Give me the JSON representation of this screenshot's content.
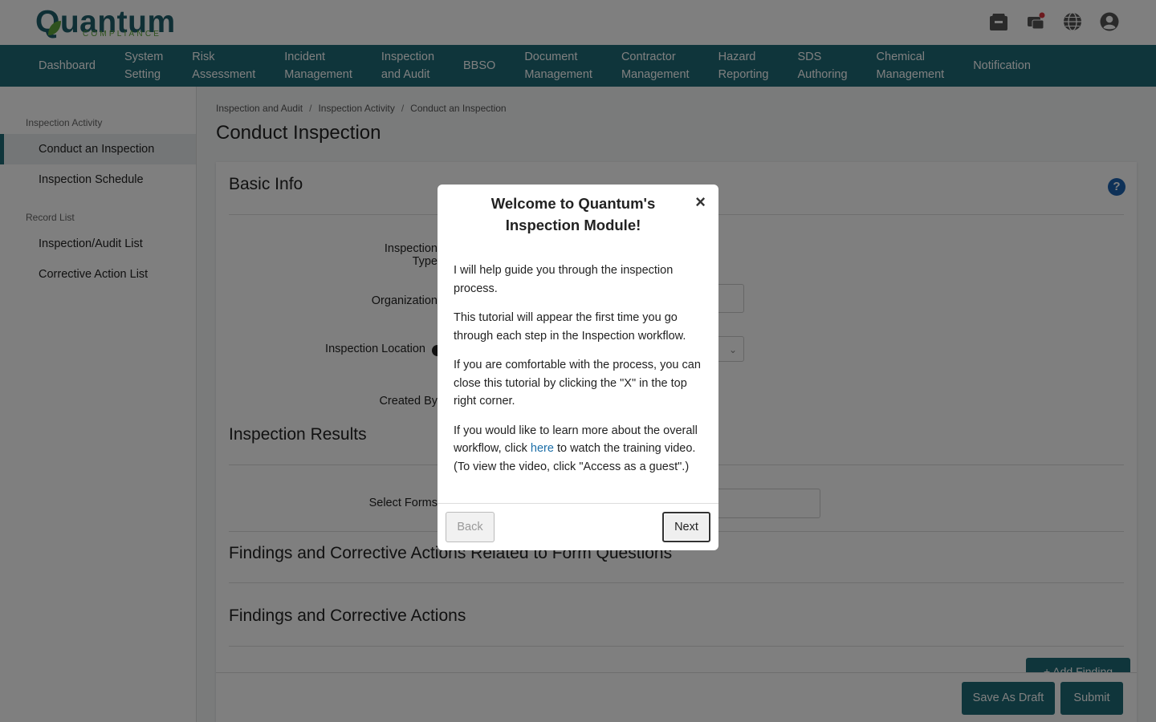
{
  "brand": {
    "name": "Quantum",
    "tagline": "COMPLIANCE",
    "primary_color": "#1e6a76",
    "accent_color": "#5ea53c"
  },
  "header_icons": [
    "inbox-icon",
    "messages-icon",
    "globe-icon",
    "user-account-icon"
  ],
  "nav": {
    "items": [
      "Dashboard",
      "System\nSetting",
      "Risk\nAssessment",
      "Incident\nManagement",
      "Inspection\nand Audit",
      "BBSO",
      "Document\nManagement",
      "Contractor\nManagement",
      "Hazard\nReporting",
      "SDS\nAuthoring",
      "Chemical\nManagement",
      "Notification"
    ]
  },
  "sidebar": {
    "section1": "Inspection Activity",
    "item_conduct": "Conduct an Inspection",
    "item_schedule": "Inspection Schedule",
    "section2": "Record List",
    "item_list": "Inspection/Audit List",
    "item_corrective": "Corrective Action List"
  },
  "breadcrumb": {
    "b1": "Inspection and Audit",
    "sep": "/",
    "b2": "Inspection Activity",
    "b3": "Conduct an Inspection"
  },
  "page_title": "Conduct Inspection",
  "form": {
    "basic_info": "Basic Info",
    "inspection_type": "Inspection Type",
    "organization": "Organization",
    "inspection_location": "Inspection Location",
    "created_by": "Created By",
    "inspection_results": "Inspection Results",
    "select_forms": "Select Forms",
    "findings_related": "Findings and Corrective Actions Related to Form Questions",
    "findings": "Findings and Corrective Actions",
    "add_finding": "+ Add Finding"
  },
  "actions": {
    "save_draft": "Save As Draft",
    "submit": "Submit"
  },
  "modal": {
    "title": "Welcome to Quantum's Inspection Module!",
    "close": "×",
    "p1": "I will help guide you through the inspection process.",
    "p2": "This tutorial will appear the first time you go through each step in the Inspection workflow.",
    "p3": "If you are comfortable with the process, you can close this tutorial by clicking the \"X\" in the top right corner.",
    "p4_a": "If you would like to learn more about the overall workflow, click ",
    "p4_link": "here",
    "p4_b": " to watch the training video. (To view the video, click \"Access as a guest\".)",
    "back": "Back",
    "next": "Next"
  }
}
